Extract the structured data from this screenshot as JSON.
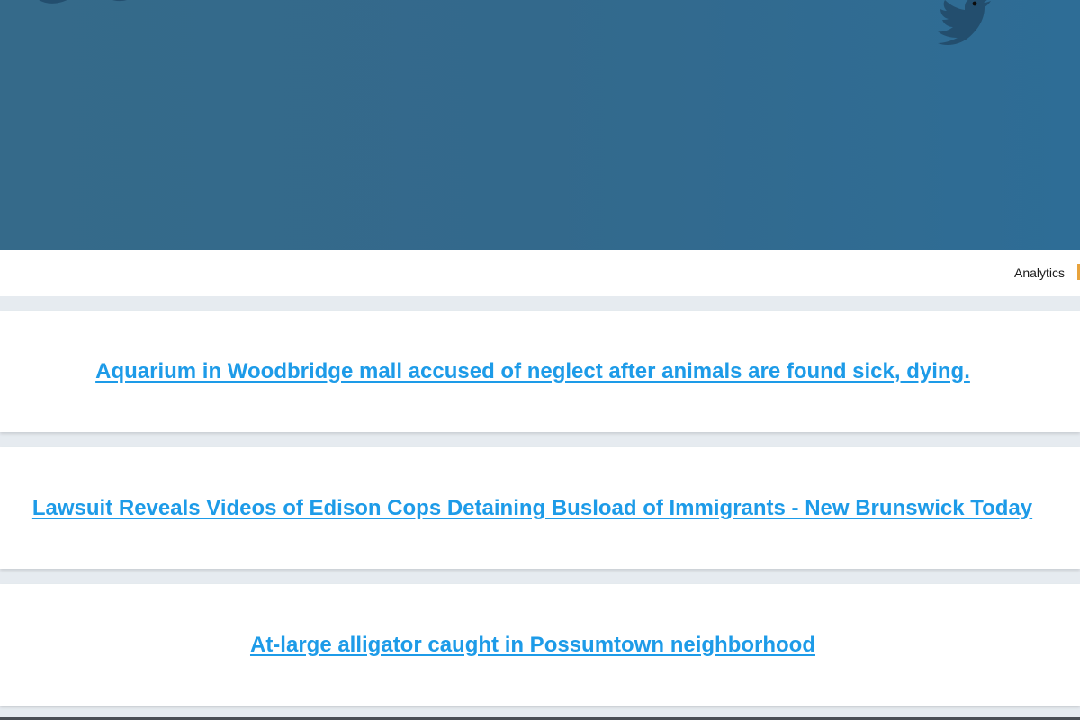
{
  "nav": {
    "analytics_label": "Analytics"
  },
  "articles": [
    {
      "title": "Aquarium in Woodbridge mall accused of neglect after animals are found sick, dying."
    },
    {
      "title": "Lawsuit Reveals Videos of Edison Cops Detaining Busload of Immigrants - New Brunswick Today"
    },
    {
      "title": "At-large alligator caught in Possumtown neighborhood"
    }
  ],
  "icons": {
    "hero_birds": "twitter-bird-icon"
  },
  "colors": {
    "hero_background": "#33698c",
    "link": "#1d9be8",
    "page_background": "#e6ebf0",
    "bird": "#234e6e"
  }
}
